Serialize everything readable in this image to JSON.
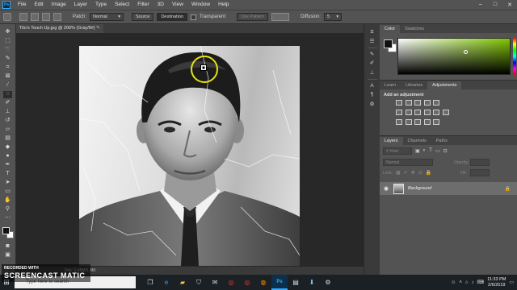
{
  "menubar": {
    "logo": "Ps",
    "items": [
      "File",
      "Edit",
      "Image",
      "Layer",
      "Type",
      "Select",
      "Filter",
      "3D",
      "View",
      "Window",
      "Help"
    ],
    "controls": [
      "–",
      "□",
      "✕"
    ]
  },
  "options": {
    "patch_label": "Patch:",
    "patch_value": "Normal",
    "source_label": "Source",
    "destination_label": "Destination",
    "transparent_label": "Transparent",
    "use_pattern_label": "Use Pattern",
    "diffusion_label": "Diffusion:",
    "diffusion_value": "5"
  },
  "document": {
    "tab_title": "Tito's Touch Up.jpg @ 200% (Gray/8#) *",
    "close": "×",
    "status": "Doc: 1.45M/1.4M"
  },
  "panels": {
    "color_tab": "Color",
    "swatches_tab": "Swatches",
    "learn_tab": "Learn",
    "libraries_tab": "Libraries",
    "adjustments_tab": "Adjustments",
    "add_adjustment": "Add an adjustment",
    "layers_tab": "Layers",
    "channels_tab": "Channels",
    "paths_tab": "Paths",
    "kind_filter": "Kind",
    "blend_mode": "Normal",
    "opacity_label": "Opacity:",
    "lock_label": "Lock:",
    "fill_label": "Fill:",
    "layer_name": "Background"
  },
  "taskbar": {
    "search_placeholder": "Type here to search",
    "time": "11:33 PM",
    "date": "2/6/2019"
  },
  "watermark": {
    "top": "RECORDED WITH",
    "brand": "SCREENCAST MATIC"
  },
  "colors": {
    "accent_ring": "#e8e210",
    "panel_bg": "#535353",
    "ps_blue": "#31a8ff"
  }
}
